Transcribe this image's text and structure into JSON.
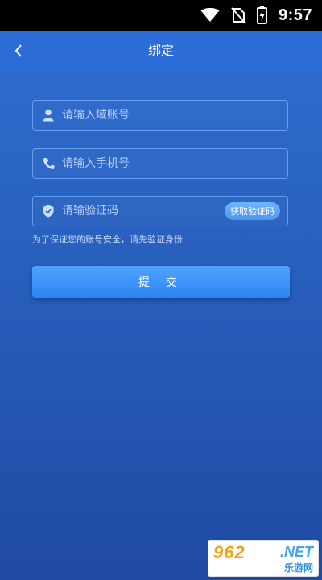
{
  "status_bar": {
    "time": "9:57",
    "icons": [
      "wifi-icon",
      "no-sim-icon",
      "battery-charging-icon"
    ]
  },
  "header": {
    "title": "绑定",
    "back_icon": "chevron-left-icon"
  },
  "form": {
    "account": {
      "placeholder": "请输入域账号",
      "value": "",
      "icon": "user-icon"
    },
    "phone": {
      "placeholder": "请输入手机号",
      "value": "",
      "icon": "phone-icon"
    },
    "code": {
      "placeholder": "请输验证码",
      "value": "",
      "icon": "shield-icon"
    },
    "get_code_label": "获取验证码",
    "hint": "为了保证您的账号安全，请先验证身份",
    "submit_label": "提 交"
  },
  "watermark": {
    "brand_digits": "962",
    "brand_domain": ".NET",
    "brand_cn": "乐游网"
  },
  "colors": {
    "background_top": "#2f6fd2",
    "background_bottom": "#1f4aa3",
    "header": "#2b6cd6",
    "field_border": "#78afff",
    "button": "#3a90f6",
    "pill_button": "#5ca6f8"
  }
}
